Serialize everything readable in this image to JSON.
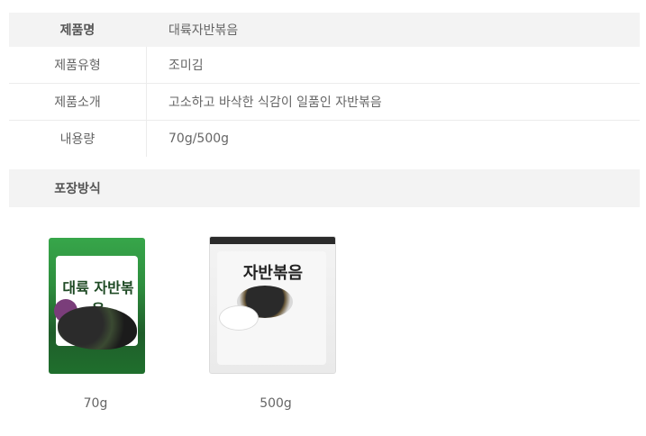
{
  "spec_table": {
    "header": {
      "label": "제품명",
      "value": "대륙자반볶음"
    },
    "rows": [
      {
        "label": "제품유형",
        "value": "조미김"
      },
      {
        "label": "제품소개",
        "value": "고소하고 바삭한 식감이 일품인 자반볶음"
      },
      {
        "label": "내용량",
        "value": "70g/500g"
      }
    ]
  },
  "packaging": {
    "title": "포장방식",
    "products": [
      {
        "caption": "70g",
        "pack_title": "대륙 자반볶음"
      },
      {
        "caption": "500g",
        "pack_title": "자반볶음"
      }
    ]
  }
}
